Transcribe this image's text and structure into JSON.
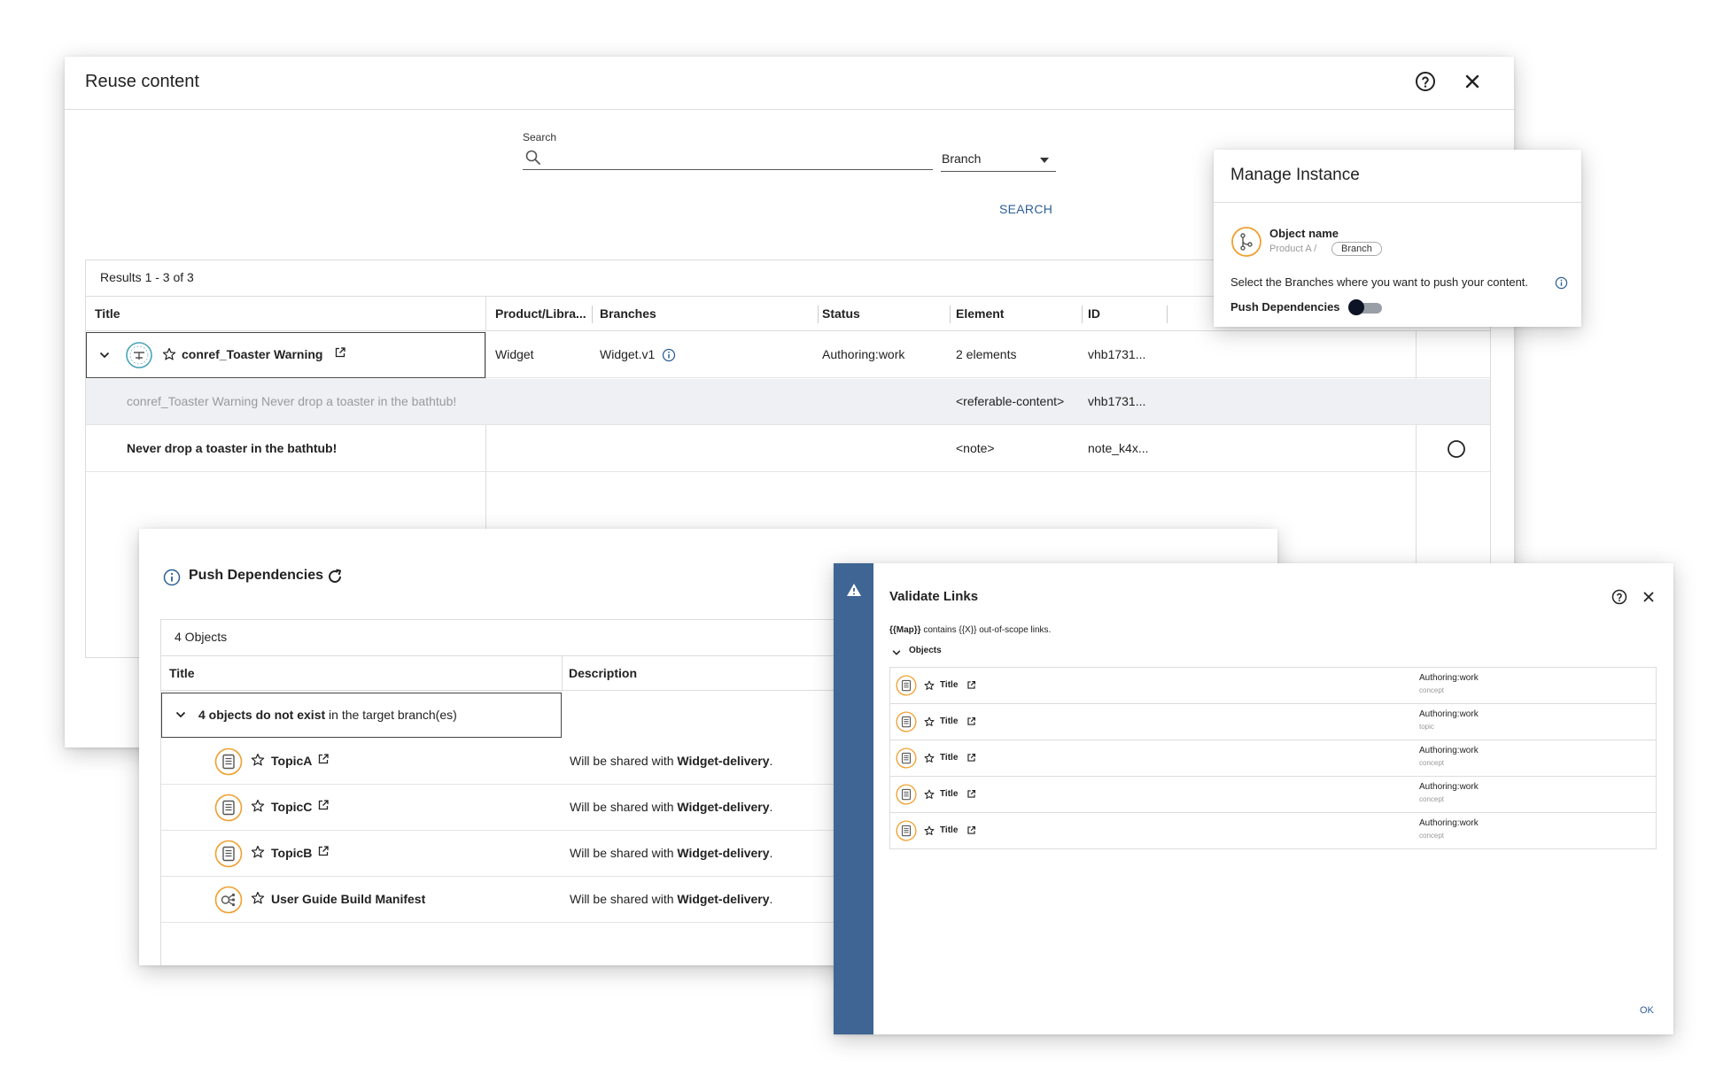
{
  "reuse": {
    "title": "Reuse content",
    "search_label": "Search",
    "search_placeholder": "",
    "branch_select": "Branch",
    "search_button": "SEARCH",
    "results_count": "Results 1 - 3 of 3",
    "columns": [
      "Title",
      "Product/Libra...",
      "Branches",
      "Status",
      "Element",
      "ID"
    ],
    "rows": [
      {
        "title": "conref_Toaster Warning",
        "product": "Widget",
        "branch": "Widget.v1",
        "status": "Authoring:work",
        "element": "2 elements",
        "id": "vhb1731..."
      },
      {
        "title": "conref_Toaster Warning Never drop a toaster in the bathtub!",
        "element": "<referable-content>",
        "id": "vhb1731..."
      },
      {
        "title": "Never drop a toaster in the bathtub!",
        "element": "<note>",
        "id": "note_k4x..."
      }
    ]
  },
  "manage": {
    "title": "Manage Instance",
    "object_name": "Object name",
    "path": "Product A /",
    "branch_chip": "Branch",
    "description": "Select the Branches where you want to push your content.",
    "push_label": "Push Dependencies",
    "push_enabled": false
  },
  "push": {
    "title": "Push Dependencies",
    "count": "4 Objects",
    "columns": [
      "Title",
      "Description"
    ],
    "group_bold": "4 objects do not exist",
    "group_rest": " in the target branch(es)",
    "desc_prefix": "Will be shared with ",
    "desc_target": "Widget-delivery",
    "desc_suffix": ".",
    "items": [
      {
        "name": "TopicA",
        "icon": "topic-icon"
      },
      {
        "name": "TopicC",
        "icon": "topic-icon"
      },
      {
        "name": "TopicB",
        "icon": "topic-icon"
      },
      {
        "name": "User Guide Build Manifest",
        "icon": "map-icon"
      }
    ]
  },
  "validate": {
    "title": "Validate Links",
    "message_bold": "{{Map}}",
    "message_rest": " contains {{X}} out-of-scope links.",
    "objects_label": "Objects",
    "ok_button": "OK",
    "items": [
      {
        "name": "Title",
        "status": "Authoring:work",
        "type": "concept"
      },
      {
        "name": "Title",
        "status": "Authoring:work",
        "type": "topic"
      },
      {
        "name": "Title",
        "status": "Authoring:work",
        "type": "concept"
      },
      {
        "name": "Title",
        "status": "Authoring:work",
        "type": "concept"
      },
      {
        "name": "Title",
        "status": "Authoring:work",
        "type": "concept"
      }
    ]
  },
  "colors": {
    "accent_blue": "#2d5f96",
    "band_blue": "#3f6594",
    "icon_orange": "#f0a030",
    "icon_teal": "#4aa3b8"
  }
}
